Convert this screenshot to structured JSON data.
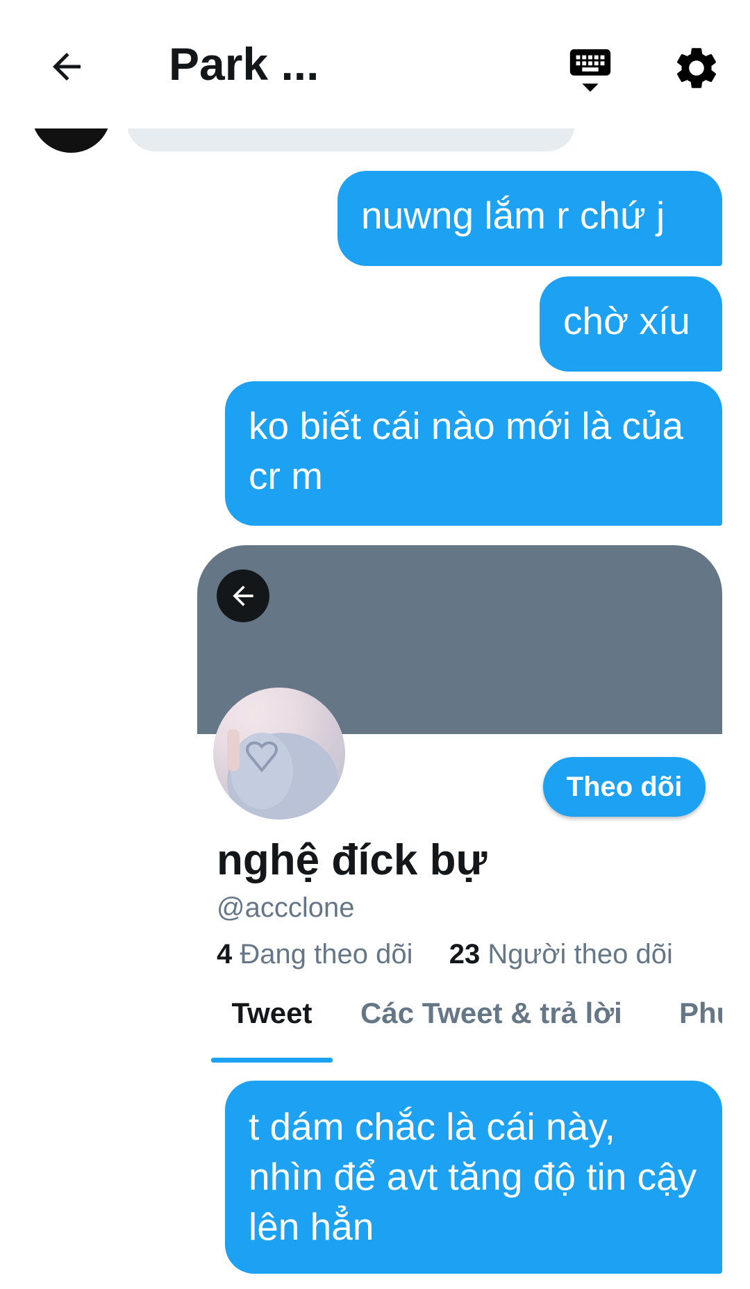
{
  "header": {
    "title": "Park ...",
    "back_icon": "arrow-left-icon",
    "keyboard_icon": "keyboard-icon",
    "settings_icon": "gear-icon"
  },
  "messages": [
    {
      "text": "nuwng lắm r chứ j",
      "sender": "me"
    },
    {
      "text": "chờ xíu",
      "sender": "me"
    },
    {
      "text": "ko biết cái nào mới là của cr m",
      "sender": "me"
    },
    {
      "text": "t dám chắc là cái này, nhìn để avt tăng độ tin cậy lên hẳn",
      "sender": "me"
    }
  ],
  "profile_card": {
    "follow_label": "Theo dõi",
    "display_name": "nghệ đíck bự",
    "handle": "@accclone",
    "following_count": "4",
    "following_label": "Đang theo dõi",
    "followers_count": "23",
    "followers_label": "Người theo dõi",
    "tabs": [
      "Tweet",
      "Các Tweet & trả lời",
      "Phư"
    ],
    "active_tab": "Tweet"
  },
  "colors": {
    "bubble": "#1da1f2",
    "banner": "#657786",
    "secondary_text": "#657786",
    "primary_text": "#14171a"
  }
}
